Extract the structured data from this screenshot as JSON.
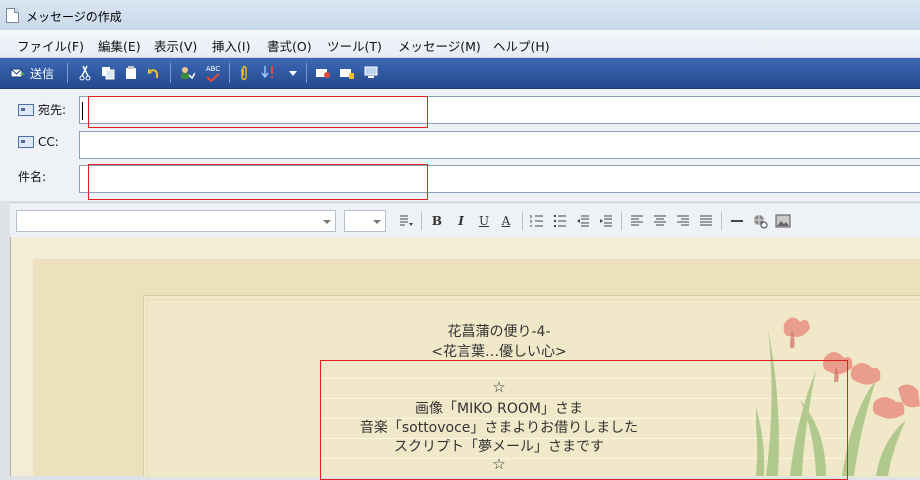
{
  "window": {
    "title": "メッセージの作成"
  },
  "menu": [
    "ファイル(F)",
    "編集(E)",
    "表示(V)",
    "挿入(I)",
    "書式(O)",
    "ツール(T)",
    "メッセージ(M)",
    "ヘルプ(H)"
  ],
  "toolbar": {
    "send_label": "送信",
    "spell_label": "ABC"
  },
  "header": {
    "to_label": "宛先:",
    "cc_label": "CC:",
    "subject_label": "件名:",
    "to_value": "",
    "cc_value": "",
    "subject_value": ""
  },
  "format": {
    "font_value": "",
    "size_value": "",
    "bold": "B",
    "italic": "I",
    "underline": "U",
    "fontcolor": "A"
  },
  "message": {
    "title": "花菖蒲の便り-4-",
    "subtitle": "<花言葉…優しい心>",
    "star1": "☆",
    "credit_image": "画像「MIKO ROOM」さま",
    "credit_music": "音楽「sottovoce」さまよりお借りしました",
    "credit_script": "スクリプト「夢メール」さまです",
    "star2": "☆"
  },
  "colors": {
    "toolbar": "#2d5399",
    "stationery": "#ece1bc",
    "highlight": "#e02020"
  }
}
